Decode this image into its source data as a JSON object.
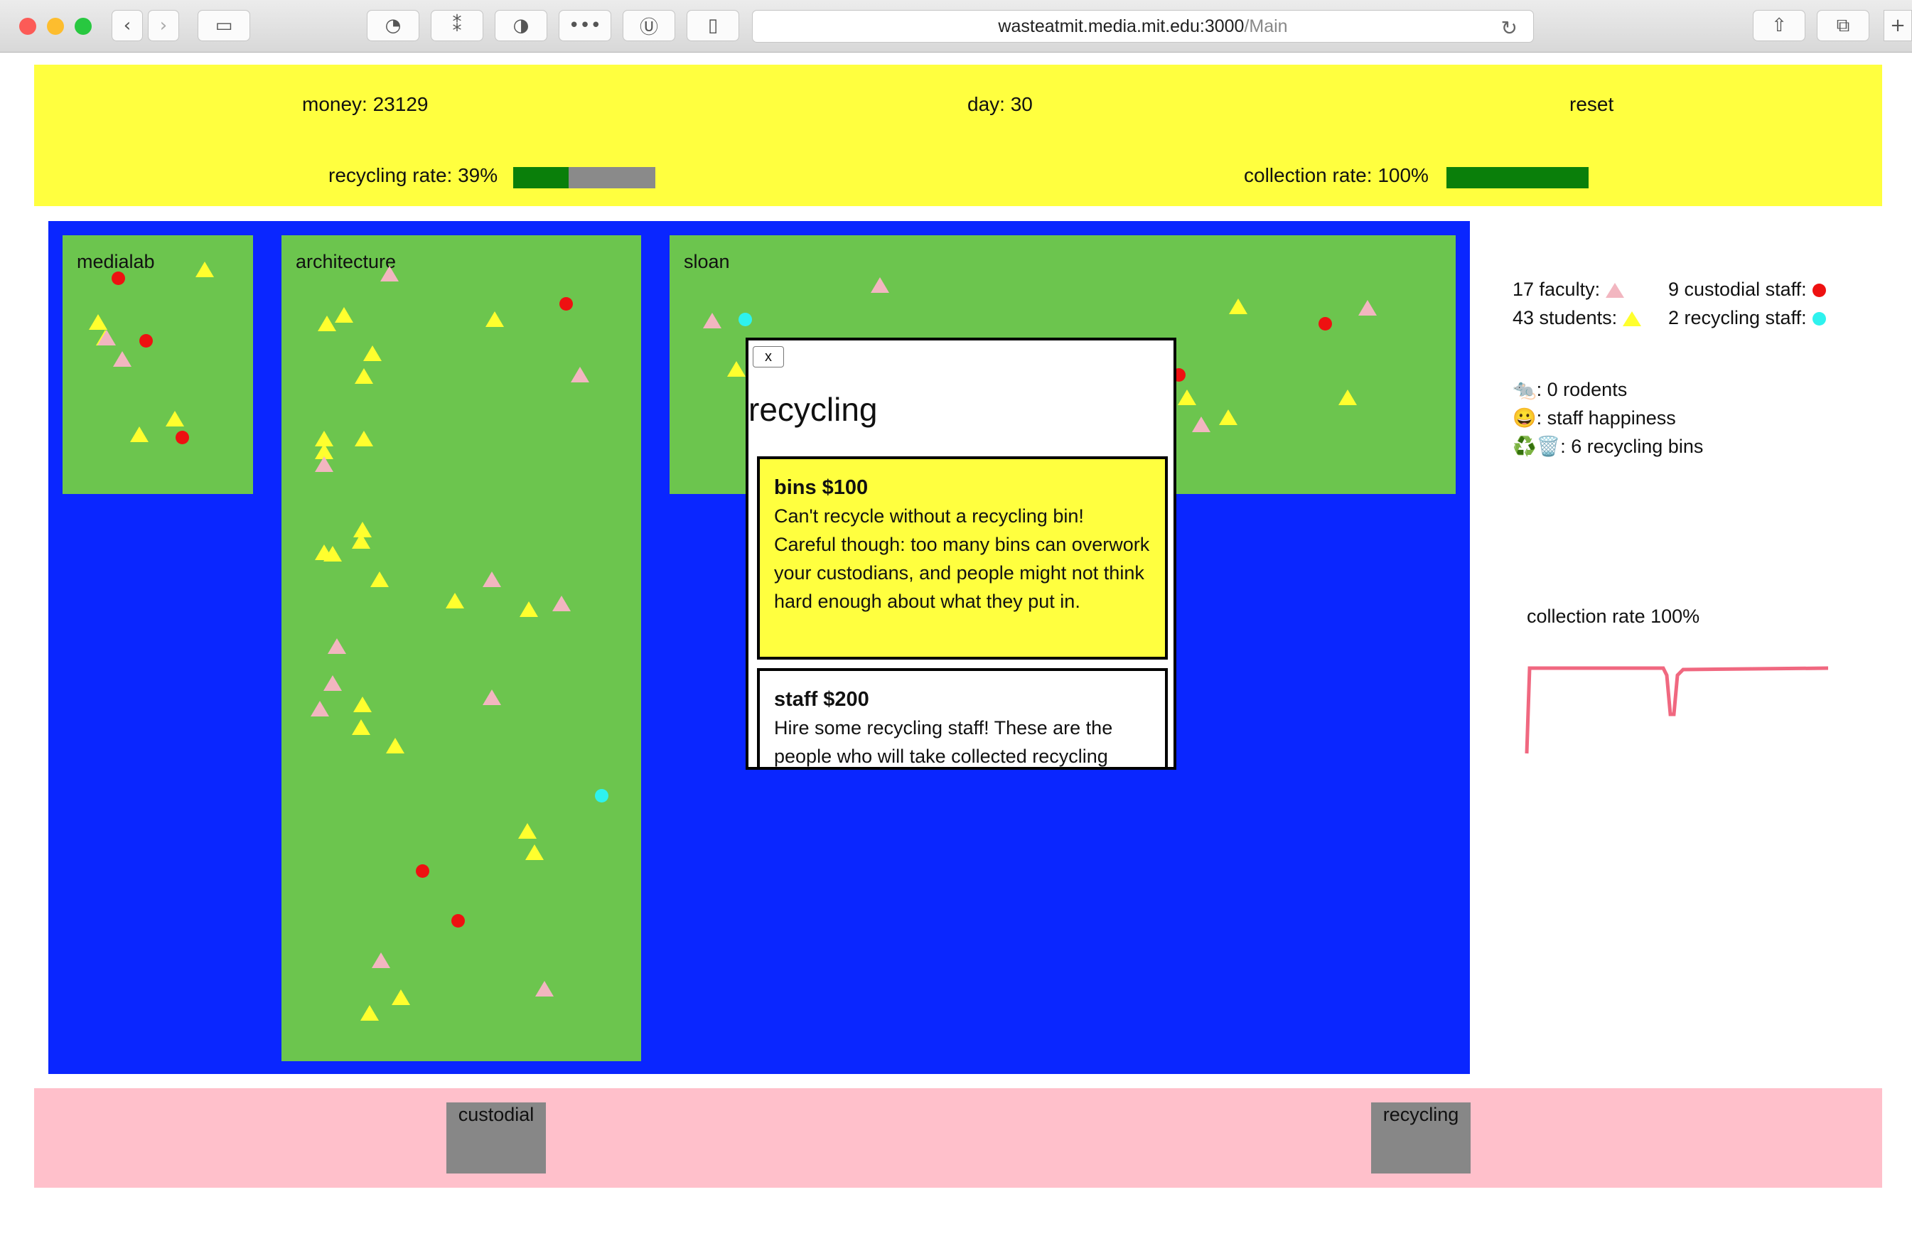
{
  "browser": {
    "url_host": "wasteatmit.media.mit.edu:3000",
    "url_path": "/Main"
  },
  "topbar": {
    "money_label": "money: 23129",
    "day_label": "day: 30",
    "reset_label": "reset",
    "recycling_rate_label": "recycling rate: 39%",
    "recycling_rate_value": 0.39,
    "collection_rate_label": "collection rate: 100%",
    "collection_rate_value": 1.0
  },
  "buildings": [
    {
      "name": "medialab"
    },
    {
      "name": "architecture"
    },
    {
      "name": "sloan"
    }
  ],
  "modal": {
    "close_label": "x",
    "title": "recycling",
    "cards": [
      {
        "title": "bins $100",
        "text": "Can't recycle without a recycling bin! Careful though: too many bins can overwork your custodians, and people might not think hard enough about what they put in."
      },
      {
        "title": "staff $200",
        "text": "Hire some recycling staff! These are the people who will take collected recycling"
      }
    ]
  },
  "stats": {
    "faculty_label": "17 faculty:",
    "students_label": "43 students:",
    "custodial_label": "9 custodial staff:",
    "recycling_staff_label": "2 recycling staff:",
    "rodents_label": ": 0 rodents",
    "happiness_label": ": staff happiness",
    "bins_label": ": 6 recycling bins",
    "rodent_icon": "🐀",
    "happiness_icon": "😀",
    "recycle_icon": "♻️",
    "trash_icon": "🗑️"
  },
  "collection_chart": {
    "label": "collection rate 100%",
    "color": "#f06880"
  },
  "bottombar": {
    "custodial_label": "custodial",
    "recycling_label": "recycling"
  },
  "colors": {
    "student": "#ffff2e",
    "faculty": "#f2b6c0",
    "custodial": "#ee1111",
    "recycling_staff": "#2ef2ee",
    "campus": "#0a26ff",
    "building": "#6cc54e",
    "topbar": "#ffff3f",
    "bottombar": "#ffc0cb"
  }
}
